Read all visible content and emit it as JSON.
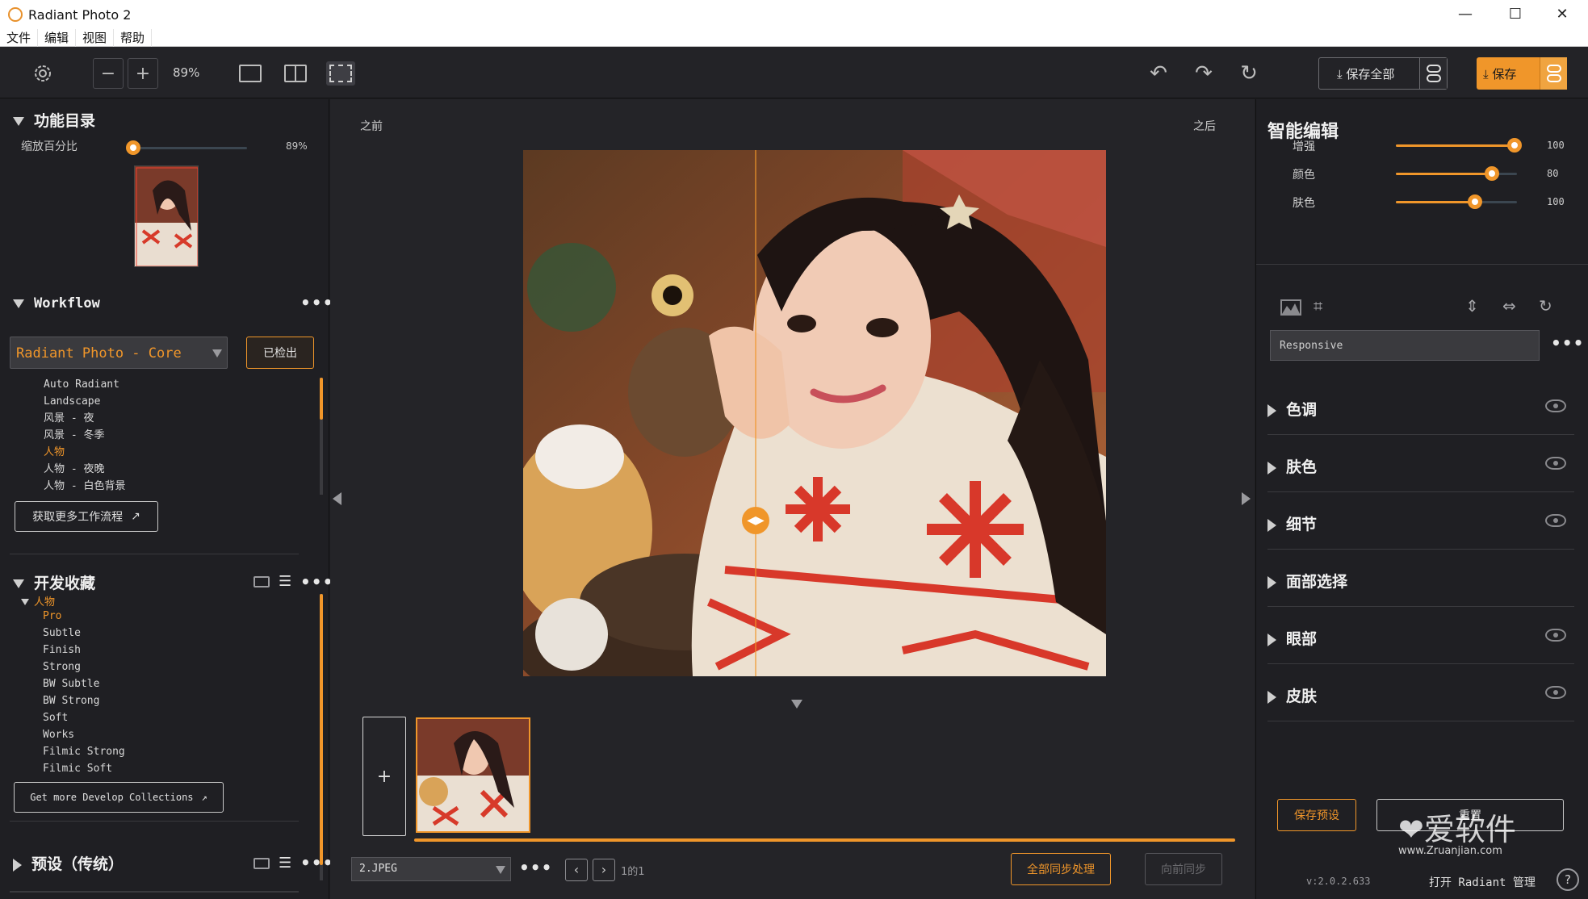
{
  "window": {
    "title": "Radiant Photo 2",
    "controls": [
      "—",
      "☐",
      "✕"
    ]
  },
  "menu": [
    "文件",
    "编辑",
    "视图",
    "帮助"
  ],
  "toolbar": {
    "zoom": "89%",
    "save_all_label": "保存全部",
    "save_label": "保存",
    "accent": "#f0962a"
  },
  "navigator": {
    "title": "功能目录",
    "zoom_label": "缩放百分比",
    "zoom_value": "89%",
    "zoom_fraction": 0.0
  },
  "workflow": {
    "title": "Workflow",
    "selected": "Radiant Photo - Core",
    "checkout_label": "已检出",
    "items": [
      "Auto Radiant",
      "Landscape",
      "风景 - 夜",
      "风景 - 冬季",
      "人物",
      "人物 - 夜晚",
      "人物 - 白色背景"
    ],
    "active_item": "人物",
    "more_label": "获取更多工作流程"
  },
  "collections": {
    "title": "开发收藏",
    "group": "人物",
    "items": [
      "Pro",
      "Subtle",
      "Finish",
      "Strong",
      "BW Subtle",
      "BW Strong",
      "Soft",
      "Works",
      "Filmic Strong",
      "Filmic Soft"
    ],
    "active_item": "Pro",
    "more_label": "Get more Develop Collections"
  },
  "presets": {
    "title": "预设（传统）"
  },
  "viewer": {
    "before_label": "之前",
    "after_label": "之后"
  },
  "filmstrip": {
    "format": "2.JPEG",
    "page_info": "1的1",
    "sync_all_label": "全部同步处理",
    "sync_prev_label": "向前同步",
    "add_label": "+"
  },
  "smart_edit": {
    "title": "智能编辑",
    "sliders": [
      {
        "label": "增强",
        "value": 100,
        "fraction": 0.98
      },
      {
        "label": "颜色",
        "value": 80,
        "fraction": 0.79
      },
      {
        "label": "肤色",
        "value": 100,
        "fraction": 0.65
      }
    ]
  },
  "mode": {
    "selected": "Responsive"
  },
  "adjustments": [
    {
      "label": "色调",
      "eye": true
    },
    {
      "label": "肤色",
      "eye": true
    },
    {
      "label": "细节",
      "eye": true
    },
    {
      "label": "面部选择",
      "eye": false
    },
    {
      "label": "眼部",
      "eye": true
    },
    {
      "label": "皮肤",
      "eye": true
    }
  ],
  "footer": {
    "save_preset_label": "保存预设",
    "reset_label": "重置",
    "version": "v:2.0.2.633",
    "manage_label": "打开 Radiant 管理",
    "help": "?",
    "watermark_title": "爱软件",
    "watermark_url": "www.Zruanjian.com"
  }
}
